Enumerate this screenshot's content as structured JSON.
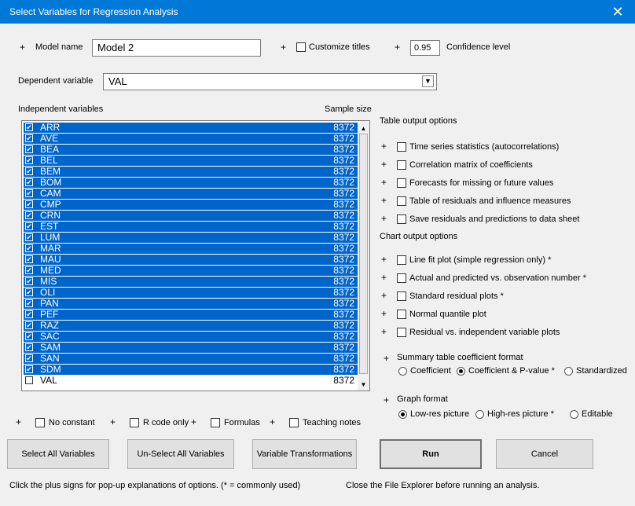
{
  "window": {
    "title": "Select Variables for Regression Analysis",
    "close_glyph": "✕"
  },
  "model_name": {
    "label": "Model name",
    "value": "Model 2"
  },
  "customize_titles": {
    "label": "Customize titles",
    "checked": false
  },
  "confidence": {
    "value": "0.95",
    "label": "Confidence level"
  },
  "dependent": {
    "label": "Dependent variable",
    "value": "VAL"
  },
  "independent": {
    "header": "Independent variables",
    "size_header": "Sample size",
    "rows": [
      {
        "name": "ARR",
        "size": "8372",
        "checked": true
      },
      {
        "name": "AVE",
        "size": "8372",
        "checked": true
      },
      {
        "name": "BEA",
        "size": "8372",
        "checked": true
      },
      {
        "name": "BEL",
        "size": "8372",
        "checked": true
      },
      {
        "name": "BEM",
        "size": "8372",
        "checked": true
      },
      {
        "name": "BOM",
        "size": "8372",
        "checked": true
      },
      {
        "name": "CAM",
        "size": "8372",
        "checked": true
      },
      {
        "name": "CMP",
        "size": "8372",
        "checked": true
      },
      {
        "name": "CRN",
        "size": "8372",
        "checked": true
      },
      {
        "name": "EST",
        "size": "8372",
        "checked": true
      },
      {
        "name": "LUM",
        "size": "8372",
        "checked": true
      },
      {
        "name": "MAR",
        "size": "8372",
        "checked": true
      },
      {
        "name": "MAU",
        "size": "8372",
        "checked": true
      },
      {
        "name": "MED",
        "size": "8372",
        "checked": true
      },
      {
        "name": "MIS",
        "size": "8372",
        "checked": true
      },
      {
        "name": "OLI",
        "size": "8372",
        "checked": true
      },
      {
        "name": "PAN",
        "size": "8372",
        "checked": true
      },
      {
        "name": "PEF",
        "size": "8372",
        "checked": true
      },
      {
        "name": "RAZ",
        "size": "8372",
        "checked": true
      },
      {
        "name": "SAC",
        "size": "8372",
        "checked": true
      },
      {
        "name": "SAM",
        "size": "8372",
        "checked": true
      },
      {
        "name": "SAN",
        "size": "8372",
        "checked": true
      },
      {
        "name": "SDM",
        "size": "8372",
        "checked": true
      },
      {
        "name": "VAL",
        "size": "8372",
        "checked": false
      }
    ]
  },
  "table_output": {
    "header": "Table output options",
    "options": [
      "Time series statistics (autocorrelations)",
      "Correlation matrix of coefficients",
      "Forecasts for missing or future values",
      "Table of residuals and influence measures",
      "Save residuals and predictions to data sheet"
    ]
  },
  "chart_output": {
    "header": "Chart output options",
    "options": [
      "Line fit plot (simple regression only) *",
      "Actual and predicted vs. observation number *",
      "Standard residual plots *",
      "Normal quantile plot",
      "Residual vs. independent variable plots"
    ]
  },
  "coef_format": {
    "header": "Summary table coefficient format",
    "options": [
      "Coefficient",
      "Coefficient & P-value *",
      "Standardized"
    ],
    "selected": 1
  },
  "graph_format": {
    "header": "Graph format",
    "options": [
      "Low-res picture",
      "High-res picture *",
      "Editable"
    ],
    "selected": 0
  },
  "bottom_checks": [
    "No constant",
    "R code only",
    "Formulas",
    "Teaching notes"
  ],
  "buttons": {
    "select_all": "Select All Variables",
    "unselect_all": "Un-Select All Variables",
    "transform": "Variable Transformations",
    "run": "Run",
    "cancel": "Cancel"
  },
  "footer": {
    "hint": "Click the plus signs for pop-up explanations of options.   (* = commonly used)",
    "note": "Close the File Explorer before running an analysis."
  },
  "glyphs": {
    "plus": "+",
    "check": "✔",
    "arrow_down": "▼",
    "arrow_up": "▲"
  },
  "colors": {
    "titlebar": "#0078d7",
    "selection": "#0065ca",
    "dialog": "#f0f0f0"
  }
}
